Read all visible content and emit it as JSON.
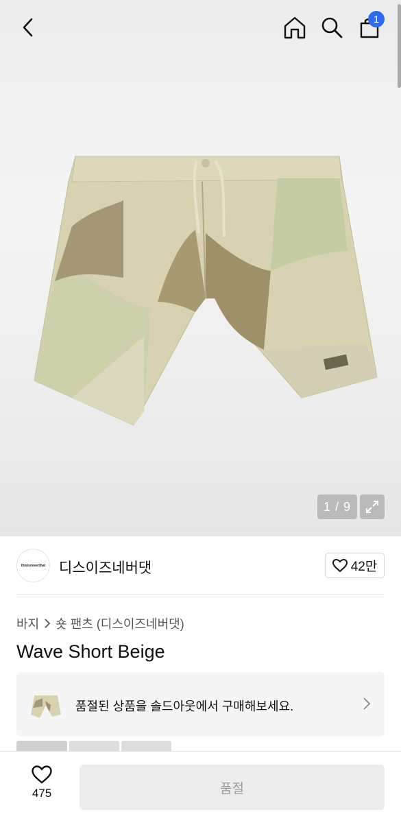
{
  "header": {
    "back_icon": "chevron-left-icon",
    "home_icon": "home-icon",
    "search_icon": "search-icon",
    "cart_icon": "shopping-bag-icon",
    "cart_badge": "1",
    "badge_color": "#2f6bf2"
  },
  "gallery": {
    "counter": "1 / 9",
    "expand_icon": "expand-icon"
  },
  "brand": {
    "logo_text": "thisisneverthat",
    "name": "디스이즈네버댓",
    "likes": "42만"
  },
  "breadcrumb": {
    "category": "바지",
    "subcategory": "숏 팬츠 (디스이즈네버댓)"
  },
  "product": {
    "title": "Wave Short Beige"
  },
  "soldout_banner": {
    "text": "품절된 상품을 솔드아웃에서 구매해보세요."
  },
  "bottom_bar": {
    "wish_count": "475",
    "buy_label": "품절"
  }
}
